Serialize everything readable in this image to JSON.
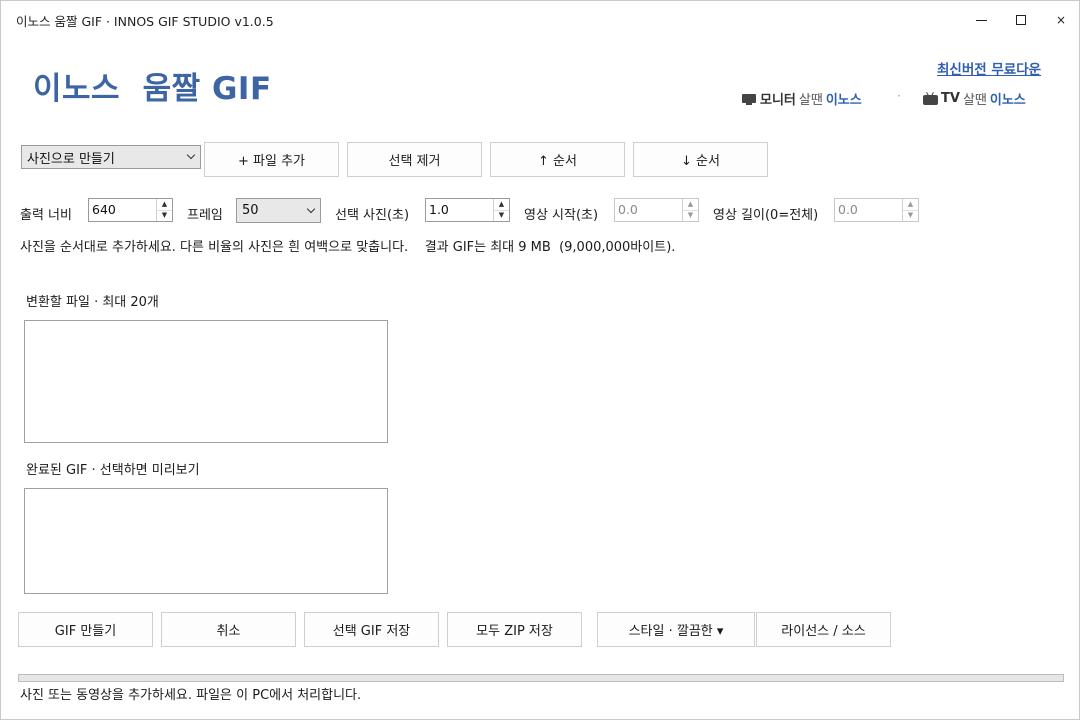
{
  "window": {
    "title": "이노스  움짤 GIF · INNOS GIF STUDIO v1.0.5",
    "close_glyph": "×"
  },
  "header": {
    "brand": "이노스  움짤 GIF",
    "latest_link": "최신버전 무료다운",
    "promo_monitor": {
      "icon": "monitor-icon",
      "kw": "모니터",
      "mid": "살땐",
      "brand": "이노스"
    },
    "promo_separator": "·",
    "promo_tv": {
      "icon": "tv-icon",
      "kw": "TV",
      "mid": "살땐",
      "brand": "이노스"
    }
  },
  "toolbar": {
    "mode_select": "사진으로 만들기",
    "add_files": "+ 파일 추가",
    "remove_selected": "선택 제거",
    "move_up": "↑ 순서",
    "move_down": "↓ 순서"
  },
  "settings": {
    "width_label": "출력 너비",
    "width_value": "640",
    "frame_label": "프레임",
    "frame_value": "50",
    "photo_sec_label": "선택 사진(초)",
    "photo_sec_value": "1.0",
    "video_start_label": "영상 시작(초)",
    "video_start_value": "0.0",
    "video_len_label": "영상 길이(0=전체)",
    "video_len_value": "0.0"
  },
  "info_text": "사진을 순서대로 추가하세요. 다른 비율의 사진은 흰 여백으로 맞춥니다.    결과 GIF는 최대 9 MB  (9,000,000바이트).",
  "files_section": {
    "label": "변환할 파일 · 최대 20개"
  },
  "done_section": {
    "label": "완료된 GIF · 선택하면 미리보기"
  },
  "actions": {
    "make_gif": "GIF 만들기",
    "cancel": "취소",
    "save_selected": "선택 GIF 저장",
    "save_zip": "모두 ZIP 저장",
    "style": "스타일 · 깔끔한 ▾",
    "license": "라이선스 / 소스"
  },
  "progress": {
    "value": 0
  },
  "status_text": "사진 또는 동영상을 추가하세요. 파일은 이 PC에서 처리합니다."
}
